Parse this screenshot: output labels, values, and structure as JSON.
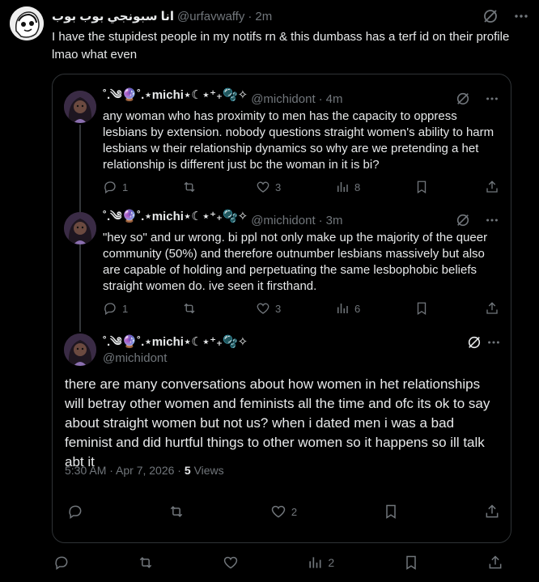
{
  "outer_tweet": {
    "display_name": "انا سبونجي بوب بوب",
    "handle": "@urfavwaffy",
    "time": "2m",
    "text": "I have the stupidest people in my notifs rn & this dumbass has a terf id on their profile lmao what even"
  },
  "quote": {
    "tweets": [
      {
        "display_name": "˚.༄🔮˚.⋆michi⋆☾⋆⁺₊🫧✧",
        "handle": "@michidont",
        "time": "4m",
        "text": "any woman who has proximity to men has the capacity to oppress lesbians by extension. nobody questions straight women's ability to harm lesbians w their relationship dynamics so why are we pretending a het relationship is different just bc the woman in it is bi?",
        "replies": "1",
        "reposts": "",
        "likes": "3",
        "views": "8"
      },
      {
        "display_name": "˚.༄🔮˚.⋆michi⋆☾⋆⁺₊🫧✧",
        "handle": "@michidont",
        "time": "3m",
        "text": "\"hey so\" and ur wrong. bi ppl not only make up the majority of the queer community (50%) and therefore outnumber lesbians massively but also are capable of holding and perpetuating the same lesbophobic beliefs straight women do. ive seen it firsthand.",
        "replies": "1",
        "reposts": "",
        "likes": "3",
        "views": "6"
      }
    ],
    "main": {
      "display_name": "˚.༄🔮˚.⋆michi⋆☾⋆⁺₊🫧✧",
      "handle": "@michidont",
      "text": "there are many conversations about how women in het relationships will betray other women and feminists all the time and ofc its ok to say about straight women but not us? when i dated men i was a bad feminist and did hurtful things to other women so it happens so ill talk abt it",
      "timestamp": "5:30 AM · Apr 7, 2026 · ",
      "views_count": "5",
      "views_label": "Views",
      "likes": "2"
    }
  },
  "outer_actions": {
    "views": "2"
  },
  "separator": "·",
  "colors": {
    "background": "#000000",
    "text": "#e7e9ea",
    "muted": "#71767b",
    "border": "#2f3336"
  }
}
